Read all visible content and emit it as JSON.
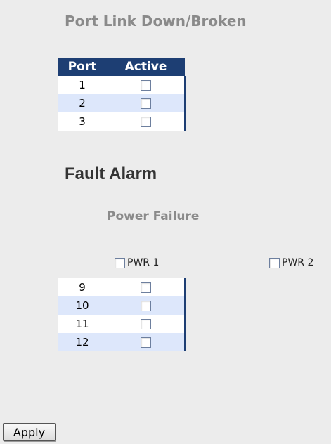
{
  "section_title": "Port Link Down/Broken",
  "port_table": {
    "headers": {
      "port": "Port",
      "active": "Active"
    },
    "rows_top": [
      {
        "port": "1",
        "active": false
      },
      {
        "port": "2",
        "active": false
      },
      {
        "port": "3",
        "active": false
      }
    ],
    "rows_bottom": [
      {
        "port": "9",
        "active": false
      },
      {
        "port": "10",
        "active": false
      },
      {
        "port": "11",
        "active": false
      },
      {
        "port": "12",
        "active": false
      }
    ]
  },
  "fault_alarm": {
    "title": "Fault Alarm",
    "power_failure_title": "Power Failure",
    "pwr1_label": "PWR 1",
    "pwr2_label": "PWR 2"
  },
  "apply_label": "Apply",
  "colors": {
    "header_bg": "#1d3e73",
    "row_alt_bg": "#dde7fb",
    "title_gray": "#8a8a8a"
  }
}
